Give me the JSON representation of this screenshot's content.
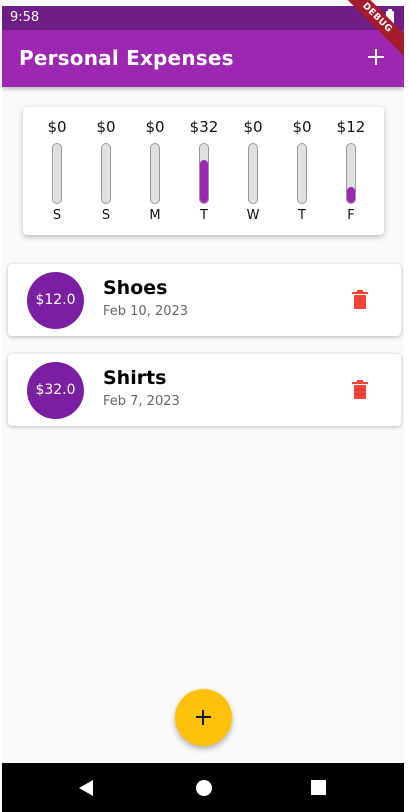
{
  "status_bar": {
    "time": "9:58"
  },
  "app_bar": {
    "title": "Personal Expenses",
    "debug_label": "DEBUG"
  },
  "colors": {
    "primary": "#9c27b0",
    "accent": "#ffc107",
    "delete": "#f44336",
    "avatar": "#7b1fa2"
  },
  "chart": {
    "bars": [
      {
        "day": "S",
        "amount": "$0",
        "fill_fraction": 0
      },
      {
        "day": "S",
        "amount": "$0",
        "fill_fraction": 0
      },
      {
        "day": "M",
        "amount": "$0",
        "fill_fraction": 0
      },
      {
        "day": "T",
        "amount": "$32",
        "fill_fraction": 0.727
      },
      {
        "day": "W",
        "amount": "$0",
        "fill_fraction": 0
      },
      {
        "day": "T",
        "amount": "$0",
        "fill_fraction": 0
      },
      {
        "day": "F",
        "amount": "$12",
        "fill_fraction": 0.273
      }
    ]
  },
  "transactions": [
    {
      "amount": "$12.0",
      "title": "Shoes",
      "date": "Feb 10, 2023"
    },
    {
      "amount": "$32.0",
      "title": "Shirts",
      "date": "Feb 7, 2023"
    }
  ],
  "icons": {
    "add": "plus-icon",
    "delete": "trash-icon",
    "fab": "plus-icon",
    "nav": [
      "back-icon",
      "home-icon",
      "recents-icon"
    ]
  }
}
